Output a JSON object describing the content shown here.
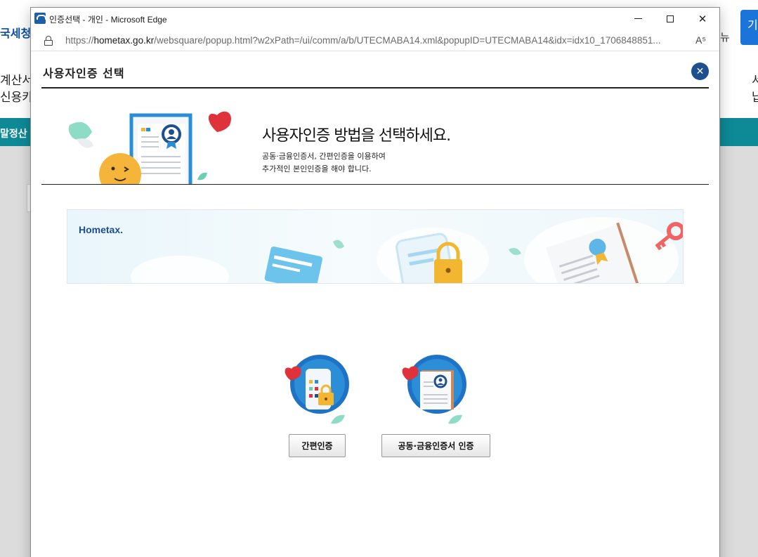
{
  "background": {
    "logo_text": "국세청",
    "left_line_1": "계산서",
    "left_line_2": "신용카",
    "teal_text": "말정산 ·",
    "menu_text": "뉴",
    "right_button_text": "기",
    "right_line_1": "서",
    "right_line_2": "납"
  },
  "window": {
    "title": "인증선택 - 개인 - Microsoft Edge",
    "minimize_label": "—",
    "maximize_label": "☐",
    "close_label": "✕"
  },
  "addressbar": {
    "url_prefix": "https://",
    "url_domain": "hometax.go.kr",
    "url_path": "/websquare/popup.html?w2xPath=/ui/comm/a/b/UTECMABA14.xml&popupID=UTECMABA14&idx=idx10_1706848851...",
    "read_aloud": "A⁵"
  },
  "popup": {
    "title": "사용자인증 선택",
    "close_label": "✕",
    "heading": "사용자인증 방법을 선택하세요.",
    "desc_line_1": "공동·금융인증서, 간편인증을 이용하여",
    "desc_line_2": "추가적인 본인인증을 해야 합니다.",
    "banner_logo": "Hometax."
  },
  "options": {
    "simple_auth": "간편인증",
    "certificate_auth": "공동·금융인증서 인증"
  },
  "colors": {
    "accent_dark_blue": "#1e4f8f",
    "teal_bar": "#0e8a97",
    "heart_red": "#e0323a",
    "leaf_green": "#6ccfb0",
    "lock_yellow": "#f2b630"
  }
}
